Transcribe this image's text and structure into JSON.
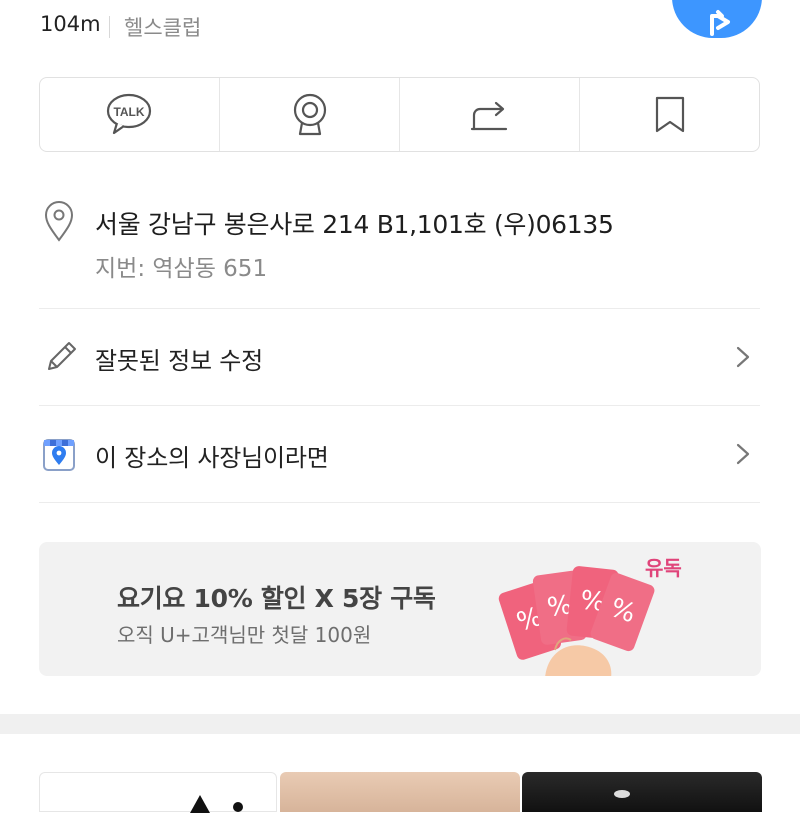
{
  "place": {
    "distance": "104m",
    "category": "헬스클럽"
  },
  "actions": [
    {
      "name": "kakaotalk",
      "label": "TALK"
    },
    {
      "name": "roadview"
    },
    {
      "name": "share"
    },
    {
      "name": "bookmark"
    }
  ],
  "address": {
    "road": "서울 강남구 봉은사로 214 B1,101호 (우)06135",
    "jibun": "지번: 역삼동 651"
  },
  "menu": {
    "edit_info": "잘못된 정보 수정",
    "owner": "이 장소의 사장님이라면"
  },
  "banner": {
    "title": "요기요 10% 할인 X 5장 구독",
    "subtitle": "오직 U+고객님만 첫달 100원",
    "brand": "유독",
    "card_symbol": "%",
    "bg_color": "#f2f2f2",
    "card_color": "#f0637d"
  },
  "colors": {
    "accent_blue": "#3d96ff"
  }
}
